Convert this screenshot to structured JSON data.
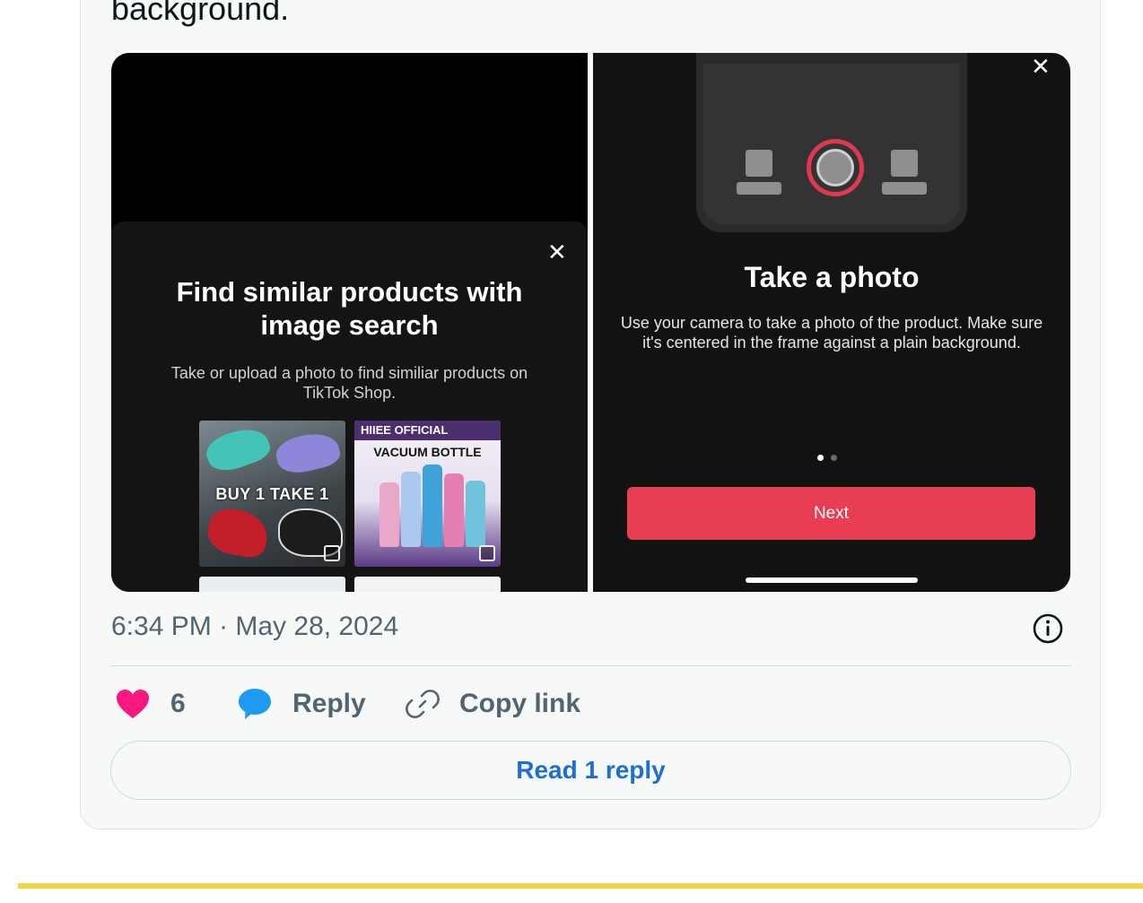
{
  "tweet": {
    "text_fragment": "background.",
    "timestamp": "6:34 PM · May 28, 2024"
  },
  "media": {
    "left_screen": {
      "close_glyph": "✕",
      "title": "Find similar products with image search",
      "subtitle": "Take or upload a photo to find similiar products on TikTok Shop.",
      "thumbnails": [
        {
          "label": "BUY 1 TAKE 1"
        },
        {
          "brand": "HIIEE OFFICIAL",
          "label": "VACUUM BOTTLE"
        }
      ]
    },
    "right_screen": {
      "close_glyph": "✕",
      "title": "Take a photo",
      "body": "Use your camera to take a photo of the product. Make sure it's centered in the frame against a plain background.",
      "page_indicator": {
        "current": 1,
        "total": 2
      },
      "next_label": "Next"
    }
  },
  "actions": {
    "like_count": "6",
    "reply_label": "Reply",
    "copy_link_label": "Copy link",
    "read_replies_label": "Read 1 reply"
  },
  "colors": {
    "like": "#f91880",
    "reply": "#1d9bf0",
    "link_text": "#1d6fd6",
    "next_button": "#e83d53",
    "accent_stripe": "#f6d440"
  },
  "icons": {
    "like": "heart-icon",
    "reply": "speech-bubble-icon",
    "copy_link": "link-icon",
    "info": "info-icon"
  }
}
